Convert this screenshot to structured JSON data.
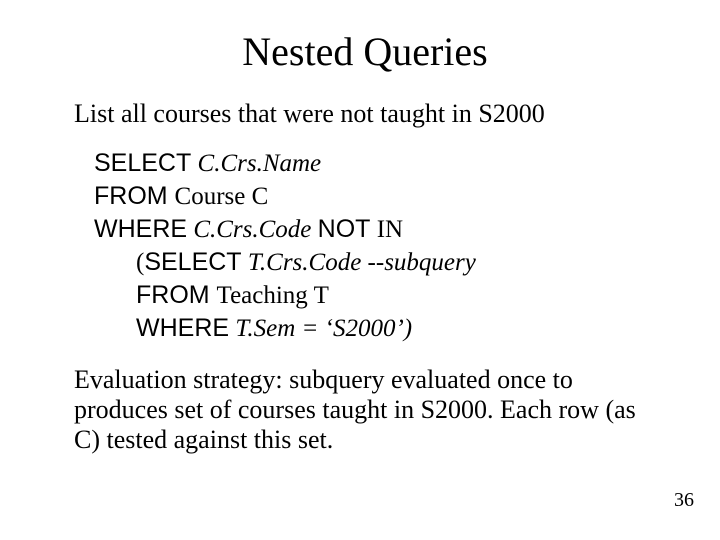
{
  "title": "Nested Queries",
  "intro": "List all courses that were not taught in S2000",
  "q": {
    "l1_kw": "SELECT",
    "l1_rest": " C.Crs.Name",
    "l2_kw": "FROM ",
    "l2_tbl": "Course",
    "l2_alias": " C",
    "l3_kw": "WHERE",
    "l3_mid": " C.Crs.Code  ",
    "l3_not": "NOT",
    "l3_in": " IN",
    "l4_open": "(",
    "l4_kw": "SELECT",
    "l4_mid": " T.Crs.Code      ",
    "l4_comment": "--subquery",
    "l5_sp": " ",
    "l5_kw": "FROM ",
    "l5_tbl": "Teaching",
    "l5_alias": " T",
    "l6_sp": " ",
    "l6_kw": "WHERE",
    "l6_rest": " T.Sem = ‘S2000’)"
  },
  "explanation": "Evaluation strategy:  subquery evaluated once to produces set of courses  taught in S2000.  Each row (as C) tested against this set.",
  "page_number": "36"
}
